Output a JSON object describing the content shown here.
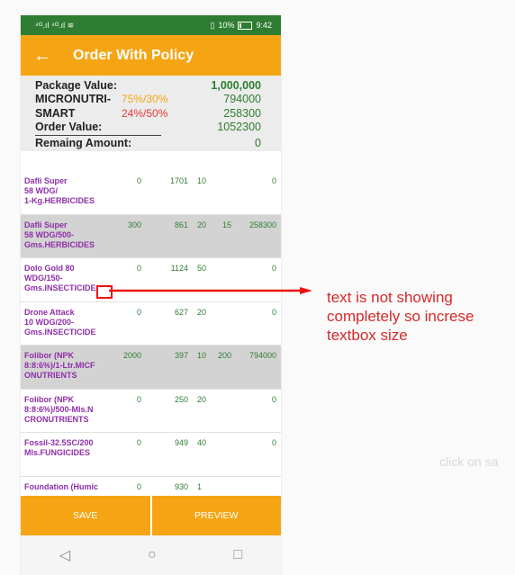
{
  "status_bar": {
    "signal": "⁴ᴳ.ıl ⁴ᴳ.ıl ≋",
    "right": "10%",
    "time": "9:42"
  },
  "app_bar": {
    "back_icon": "arrow-left-icon",
    "title": "Order With Policy"
  },
  "summary": {
    "package_value_label": "Package Value:",
    "package_value": "1,000,000",
    "micronutri_label": "MICRONUTRI-",
    "micronutri_pct": "75%/30%",
    "micronutri_value": "794000",
    "smart_label": "SMART",
    "smart_pct": "24%/50%",
    "smart_value": "258300",
    "order_value_label": "Order Value:",
    "order_value": "1052300",
    "remaining_label": "Remaing Amount:",
    "remaining_value": "0",
    "colors": {
      "micronutri_pct": "#f5a514",
      "smart_pct": "#e53935"
    }
  },
  "products": [
    {
      "name": "Dafli Super\n58 WDG/\n1-Kg.HERBICIDES",
      "c1": "0",
      "c2": "1701",
      "c3": "10",
      "c4": "",
      "c5": "0",
      "shaded": false
    },
    {
      "name": "Dafli Super\n58 WDG/500-\nGms.HERBICIDES",
      "c1": "300",
      "c2": "861",
      "c3": "20",
      "c4": "15",
      "c5": "258300",
      "shaded": true
    },
    {
      "name": "Dolo Gold 80\nWDG/150-\nGms.INSECTICIDE",
      "c1": "0",
      "c2": "1124",
      "c3": "50",
      "c4": "",
      "c5": "0",
      "shaded": false
    },
    {
      "name": "Drone Attack\n10 WDG/200-\nGms.INSECTICIDE",
      "c1": "0",
      "c2": "627",
      "c3": "20",
      "c4": "",
      "c5": "0",
      "shaded": false
    },
    {
      "name": "Folibor (NPK\n8:8:6%)/1-Ltr.MICF\nONUTRIENTS",
      "c1": "2000",
      "c2": "397",
      "c3": "10",
      "c4": "200",
      "c5": "794000",
      "shaded": true
    },
    {
      "name": "Folibor (NPK\n8:8:6%)/500-Mls.N\nCRONUTRIENTS",
      "c1": "0",
      "c2": "250",
      "c3": "20",
      "c4": "",
      "c5": "0",
      "shaded": false
    },
    {
      "name": "Fossil-32.5SC/200\nMls.FUNGICIDES",
      "c1": "0",
      "c2": "949",
      "c3": "40",
      "c4": "",
      "c5": "0",
      "shaded": false
    },
    {
      "name": "Foundation (Humic",
      "c1": "0",
      "c2": "930",
      "c3": "1",
      "c4": "",
      "c5": "",
      "shaded": false
    }
  ],
  "buttons": {
    "save": "SAVE",
    "preview": "PREVIEW"
  },
  "nav": {
    "back": "◁",
    "home": "○",
    "recent": "□"
  },
  "annotation": {
    "text": "text is not showing completely so increse textbox size",
    "color": "#d42a2a"
  },
  "background_hint": "click on sa"
}
